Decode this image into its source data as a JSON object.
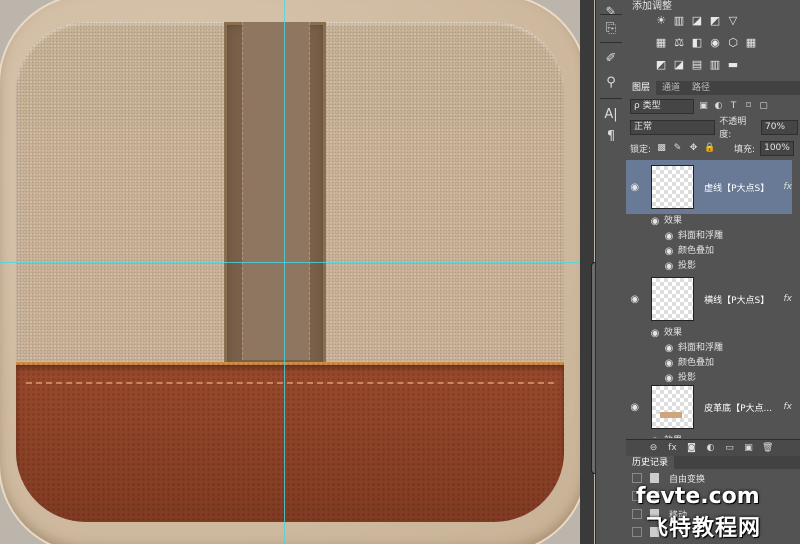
{
  "panel": {
    "adjustments_title": "添加调整",
    "adjust_icons_row1": [
      "☀",
      "▥",
      "◪",
      "◩",
      "▽"
    ],
    "adjust_icons_row2": [
      "▦",
      "⚖",
      "◧",
      "◉",
      "⬡",
      "▦"
    ],
    "adjust_icons_row3": [
      "◩",
      "◪",
      "▤",
      "▥",
      "▬"
    ],
    "tabs": [
      "图层",
      "通道",
      "路径"
    ],
    "filter_kind": "ρ 类型",
    "blend_mode": "正常",
    "opacity_label": "不透明度:",
    "opacity_value": "70%",
    "lock_label": "锁定:",
    "fill_label": "填充:",
    "fill_value": "100%",
    "layers": [
      {
        "name": "虚线【P大点S】",
        "fx": "fx",
        "effects_label": "效果",
        "effects": [
          "斜面和浮雕",
          "颜色叠加",
          "投影"
        ]
      },
      {
        "name": "横线【P大点S】",
        "fx": "fx",
        "effects_label": "效果",
        "effects": [
          "斜面和浮雕",
          "颜色叠加",
          "投影"
        ]
      },
      {
        "name": "皮革底【P大点...",
        "fx": "fx",
        "effects_label": "效果",
        "effects": []
      }
    ],
    "history_tab": "历史记录",
    "history_items": [
      "自由变换",
      "",
      "移动"
    ]
  },
  "watermark": {
    "line1": "fevte.com",
    "line2": "飞特教程网"
  },
  "colors": {
    "guide": "#43d8e6",
    "panel_bg": "#535353",
    "selected_layer": "#687a95",
    "leather": "#8c4228",
    "felt": "#cdb79c"
  }
}
